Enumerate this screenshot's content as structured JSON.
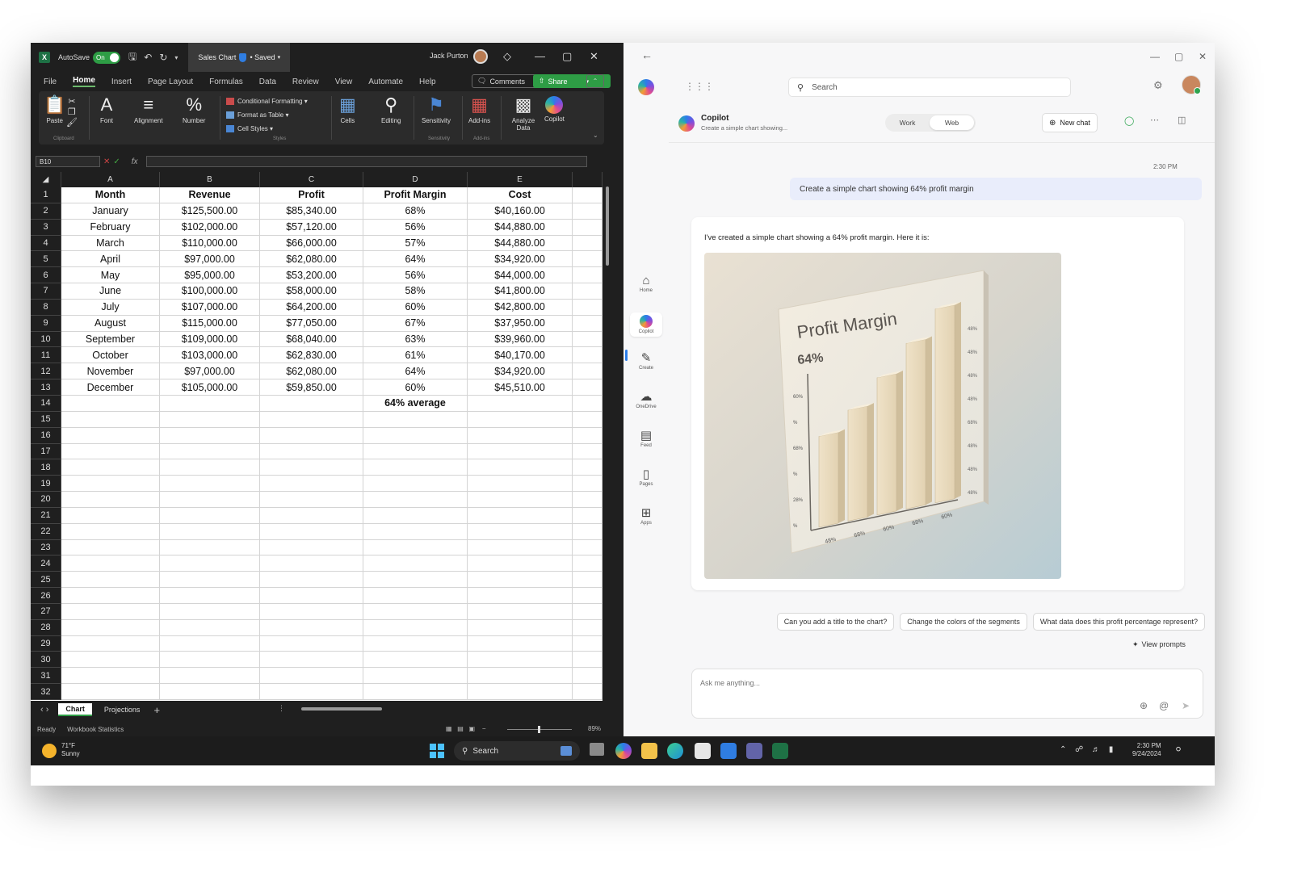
{
  "excel": {
    "autosave_label": "AutoSave",
    "autosave_state": "On",
    "doc_title": "Sales Chart",
    "doc_status": "• Saved",
    "user_name": "Jack Purton",
    "tabs": [
      "File",
      "Home",
      "Insert",
      "Page Layout",
      "Formulas",
      "Data",
      "Review",
      "View",
      "Automate",
      "Help"
    ],
    "active_tab": "Home",
    "comments_label": "Comments",
    "share_label": "Share",
    "ribbon": {
      "paste": "Paste",
      "clipboard": "Clipboard",
      "font": "Font",
      "alignment": "Alignment",
      "number": "Number",
      "conditional_formatting": "Conditional Formatting",
      "format_as_table": "Format as Table",
      "cell_styles": "Cell Styles",
      "styles": "Styles",
      "cells": "Cells",
      "editing": "Editing",
      "sensitivity": "Sensitivity",
      "sensitivity_group": "Sensitivity",
      "addins": "Add-ins",
      "addins_group": "Add-ins",
      "analyze_data": "Analyze Data",
      "copilot": "Copilot"
    },
    "name_box": "B10",
    "fx_label": "fx",
    "columns": [
      "A",
      "B",
      "C",
      "D",
      "E"
    ],
    "rows": [
      [
        "Month",
        "Revenue",
        "Profit",
        "Profit Margin",
        "Cost"
      ],
      [
        "January",
        "$125,500.00",
        "$85,340.00",
        "68%",
        "$40,160.00"
      ],
      [
        "February",
        "$102,000.00",
        "$57,120.00",
        "56%",
        "$44,880.00"
      ],
      [
        "March",
        "$110,000.00",
        "$66,000.00",
        "57%",
        "$44,880.00"
      ],
      [
        "April",
        "$97,000.00",
        "$62,080.00",
        "64%",
        "$34,920.00"
      ],
      [
        "May",
        "$95,000.00",
        "$53,200.00",
        "56%",
        "$44,000.00"
      ],
      [
        "June",
        "$100,000.00",
        "$58,000.00",
        "58%",
        "$41,800.00"
      ],
      [
        "July",
        "$107,000.00",
        "$64,200.00",
        "60%",
        "$42,800.00"
      ],
      [
        "August",
        "$115,000.00",
        "$77,050.00",
        "67%",
        "$37,950.00"
      ],
      [
        "September",
        "$109,000.00",
        "$68,040.00",
        "63%",
        "$39,960.00"
      ],
      [
        "October",
        "$103,000.00",
        "$62,830.00",
        "61%",
        "$40,170.00"
      ],
      [
        "November",
        "$97,000.00",
        "$62,080.00",
        "64%",
        "$34,920.00"
      ],
      [
        "December",
        "$105,000.00",
        "$59,850.00",
        "60%",
        "$45,510.00"
      ],
      [
        "",
        "",
        "",
        "64% average",
        ""
      ]
    ],
    "total_rows": 32,
    "sheets": [
      "Chart",
      "Projections"
    ],
    "active_sheet": "Chart",
    "status_ready": "Ready",
    "status_stats": "Workbook Statistics",
    "zoom": "89%"
  },
  "copilot": {
    "search_placeholder": "Search",
    "rail": [
      "Home",
      "Copilot",
      "Create",
      "OneDrive",
      "Feed",
      "Pages",
      "Apps"
    ],
    "active_rail": "Copilot",
    "chat_title": "Copilot",
    "chat_subtitle": "Create a simple chart showing...",
    "mode_work": "Work",
    "mode_web": "Web",
    "active_mode": "Web",
    "new_chat": "New chat",
    "timestamp": "2:30 PM",
    "user_message": "Create a simple chart showing 64% profit margin",
    "response_text": "I've created a simple chart showing a 64% profit margin. Here it is:",
    "image": {
      "title": "Profit Margin",
      "value": "64%",
      "bar_heights": [
        0.45,
        0.55,
        0.68,
        0.82,
        0.96
      ],
      "x_ticks": [
        "48%",
        "68%",
        "60%",
        "68%",
        "60%"
      ],
      "y_ticks_left": [
        "60%",
        "%",
        "68%",
        "%",
        "28%",
        "%"
      ],
      "y_ticks_right": [
        "48%",
        "48%",
        "48%",
        "48%",
        "68%",
        "48%",
        "48%",
        "48%"
      ]
    },
    "suggestions": [
      "Can you add a title to the chart?",
      "Change the colors of the segments",
      "What data does this profit percentage represent?"
    ],
    "view_prompts": "View prompts",
    "input_placeholder": "Ask me anything..."
  },
  "taskbar": {
    "temperature": "71°F",
    "weather": "Sunny",
    "search_label": "Search",
    "time": "2:30 PM",
    "date": "9/24/2024"
  },
  "colors": {
    "excel_green": "#2e9d45",
    "excel_dark": "#1f1f1f",
    "copilot_bg": "#f7f7f8",
    "user_bubble": "#e9edfb"
  }
}
